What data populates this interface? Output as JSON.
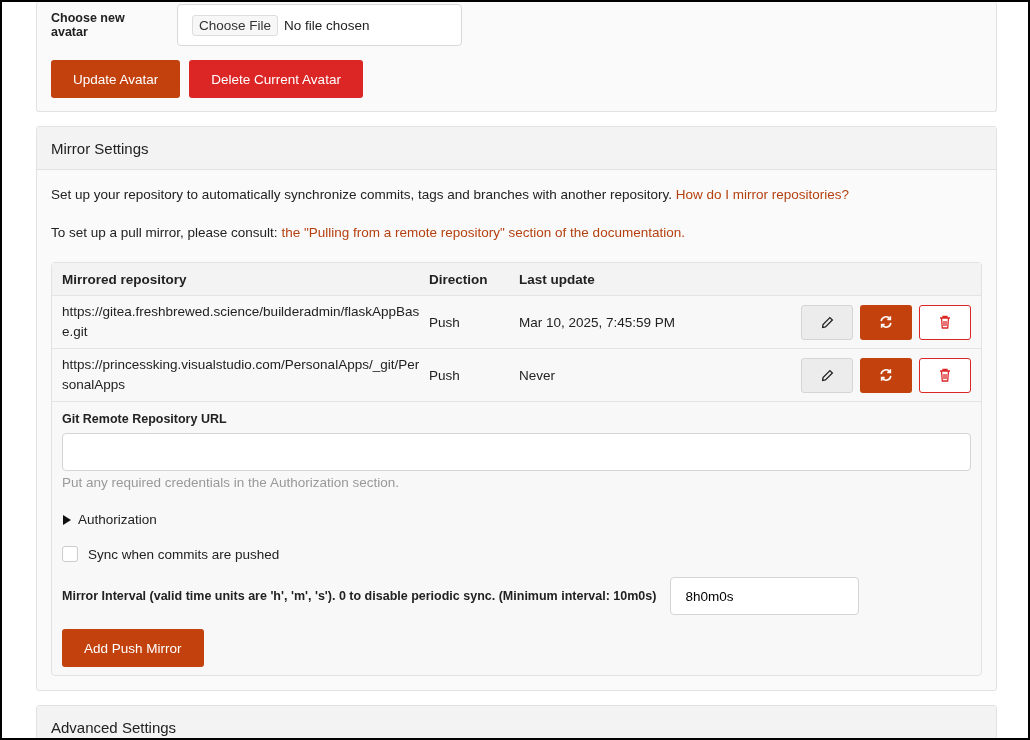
{
  "avatar": {
    "label": "Choose new avatar",
    "file_button": "Choose File",
    "file_status": "No file chosen",
    "buttons": [
      {
        "label": "Update Avatar",
        "kind": "primary"
      },
      {
        "label": "Delete Current Avatar",
        "kind": "danger"
      }
    ]
  },
  "mirror_settings": {
    "title": "Mirror Settings",
    "intro": {
      "text": "Set up your repository to automatically synchronize commits, tags and branches with another repository.",
      "link": "How do I mirror repositories?"
    },
    "pull_note": {
      "text": "To set up a pull mirror, please consult:",
      "link": "the \"Pulling from a remote repository\" section of the documentation."
    },
    "table": {
      "columns": [
        "Mirrored repository",
        "Direction",
        "Last update"
      ],
      "rows": [
        {
          "repository": "https://gitea.freshbrewed.science/builderadmin/flaskAppBase.git",
          "direction": "Push",
          "last_update": "Mar 10, 2025, 7:45:59 PM"
        },
        {
          "repository": "https://princessking.visualstudio.com/PersonalApps/_git/PersonalApps",
          "direction": "Push",
          "last_update": "Never"
        }
      ]
    },
    "form": {
      "url_label": "Git Remote Repository URL",
      "url_help": "Put any required credentials in the Authorization section.",
      "authorization": {
        "label": "Authorization",
        "expanded": false
      },
      "sync_checkbox": {
        "label": "Sync when commits are pushed",
        "checked": false
      },
      "interval": {
        "label": "Mirror Interval (valid time units are 'h', 'm', 's'). 0 to disable periodic sync. (Minimum interval: 10m0s)",
        "value": "8h0m0s"
      },
      "submit": "Add Push Mirror"
    }
  },
  "advanced_settings": {
    "title": "Advanced Settings"
  }
}
